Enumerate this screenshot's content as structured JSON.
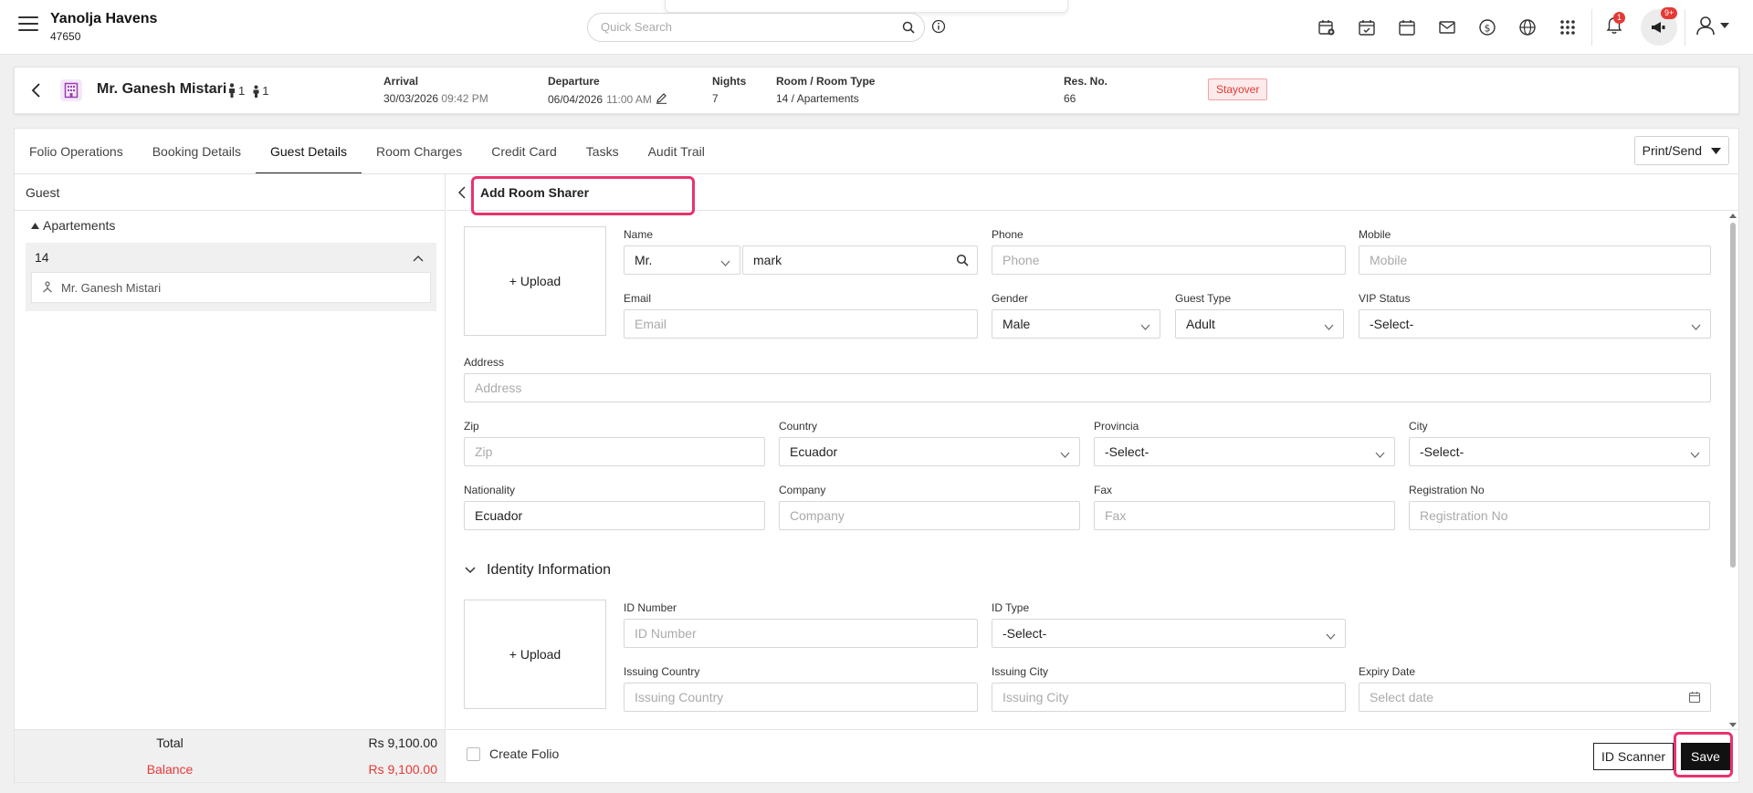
{
  "topbar": {
    "hotel_name": "Yanolja Havens",
    "hotel_id": "47650",
    "search_placeholder": "Quick Search",
    "notification_count": "1",
    "announcement_count": "9+"
  },
  "reservation": {
    "guest_name": "Mr. Ganesh Mistari",
    "adults": "1",
    "children": "1",
    "arrival_label": "Arrival",
    "arrival_date": "30/03/2026",
    "arrival_time": "09:42 PM",
    "departure_label": "Departure",
    "departure_date": "06/04/2026",
    "departure_time": "11:00 AM",
    "nights_label": "Nights",
    "nights": "7",
    "room_label": "Room / Room Type",
    "room_value": "14 / Apartements",
    "resno_label": "Res. No.",
    "resno": "66",
    "status": "Stayover"
  },
  "tabs": [
    {
      "label": "Folio Operations"
    },
    {
      "label": "Booking Details"
    },
    {
      "label": "Guest Details"
    },
    {
      "label": "Room Charges"
    },
    {
      "label": "Credit Card"
    },
    {
      "label": "Tasks"
    },
    {
      "label": "Audit Trail"
    }
  ],
  "print_send": "Print/Send",
  "left_panel": {
    "header": "Guest",
    "group": "Apartements",
    "room": "14",
    "guest": "Mr. Ganesh Mistari",
    "total_label": "Total",
    "total_amount": "Rs 9,100.00",
    "balance_label": "Balance",
    "balance_amount": "Rs 9,100.00"
  },
  "form": {
    "title": "Add Room Sharer",
    "upload_label": "+ Upload",
    "name_label": "Name",
    "salutation": "Mr.",
    "name_value": "mark",
    "phone_label": "Phone",
    "phone_placeholder": "Phone",
    "mobile_label": "Mobile",
    "mobile_placeholder": "Mobile",
    "email_label": "Email",
    "email_placeholder": "Email",
    "gender_label": "Gender",
    "gender_value": "Male",
    "guest_type_label": "Guest Type",
    "guest_type_value": "Adult",
    "vip_label": "VIP Status",
    "vip_value": "-Select-",
    "address_label": "Address",
    "address_placeholder": "Address",
    "zip_label": "Zip",
    "zip_placeholder": "Zip",
    "country_label": "Country",
    "country_value": "Ecuador",
    "provincia_label": "Provincia",
    "provincia_value": "-Select-",
    "city_label": "City",
    "city_value": "-Select-",
    "nationality_label": "Nationality",
    "nationality_value": "Ecuador",
    "company_label": "Company",
    "company_placeholder": "Company",
    "fax_label": "Fax",
    "fax_placeholder": "Fax",
    "regno_label": "Registration No",
    "regno_placeholder": "Registration No",
    "identity_title": "Identity Information",
    "id_upload_label": "+ Upload",
    "id_number_label": "ID Number",
    "id_number_placeholder": "ID Number",
    "id_type_label": "ID Type",
    "id_type_value": "-Select-",
    "issuing_country_label": "Issuing Country",
    "issuing_country_placeholder": "Issuing Country",
    "issuing_city_label": "Issuing City",
    "issuing_city_placeholder": "Issuing City",
    "expiry_label": "Expiry Date",
    "expiry_placeholder": "Select date"
  },
  "footer": {
    "create_folio": "Create Folio",
    "id_scanner": "ID Scanner",
    "save": "Save"
  },
  "colors": {
    "accent_highlight": "#e8336d",
    "status_red": "#e53935",
    "primary_dark": "#111111",
    "building_icon": "#9c3fb5"
  }
}
